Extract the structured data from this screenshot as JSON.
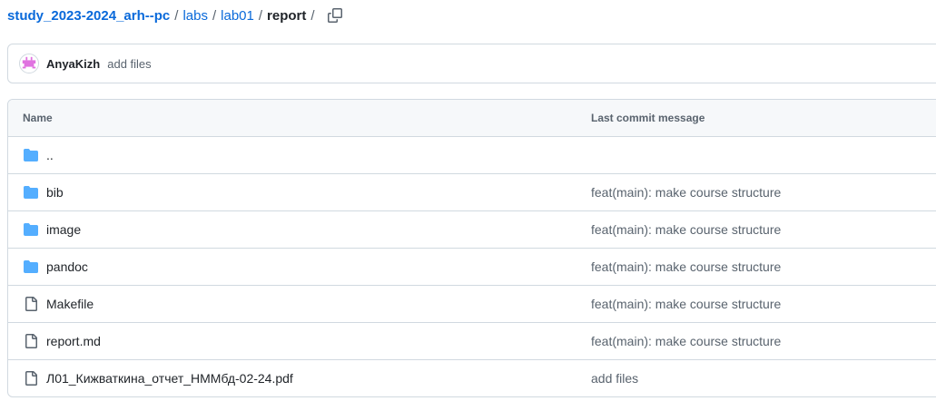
{
  "breadcrumb": {
    "repo": "study_2023-2024_arh--pc",
    "separator": "/",
    "items": [
      "labs",
      "lab01"
    ],
    "current": "report"
  },
  "latest_commit": {
    "author": "AnyaKizh",
    "message": "add files"
  },
  "table": {
    "headers": {
      "name": "Name",
      "message": "Last commit message"
    },
    "rows": [
      {
        "name": "..",
        "type": "folder",
        "message": ""
      },
      {
        "name": "bib",
        "type": "folder",
        "message": "feat(main): make course structure"
      },
      {
        "name": "image",
        "type": "folder",
        "message": "feat(main): make course structure"
      },
      {
        "name": "pandoc",
        "type": "folder",
        "message": "feat(main): make course structure"
      },
      {
        "name": "Makefile",
        "type": "file",
        "message": "feat(main): make course structure"
      },
      {
        "name": "report.md",
        "type": "file",
        "message": "feat(main): make course structure"
      },
      {
        "name": "Л01_Кижваткина_отчет_НММбд-02-24.pdf",
        "type": "file",
        "message": "add files"
      }
    ]
  },
  "colors": {
    "link": "#0969da",
    "folder": "#54aeff",
    "muted": "#59636e",
    "border": "#d1d9e0",
    "header_bg": "#f6f8fa"
  },
  "icons": {
    "copy": "copy-icon",
    "folder": "folder-icon",
    "file": "file-icon",
    "avatar": "identicon"
  }
}
